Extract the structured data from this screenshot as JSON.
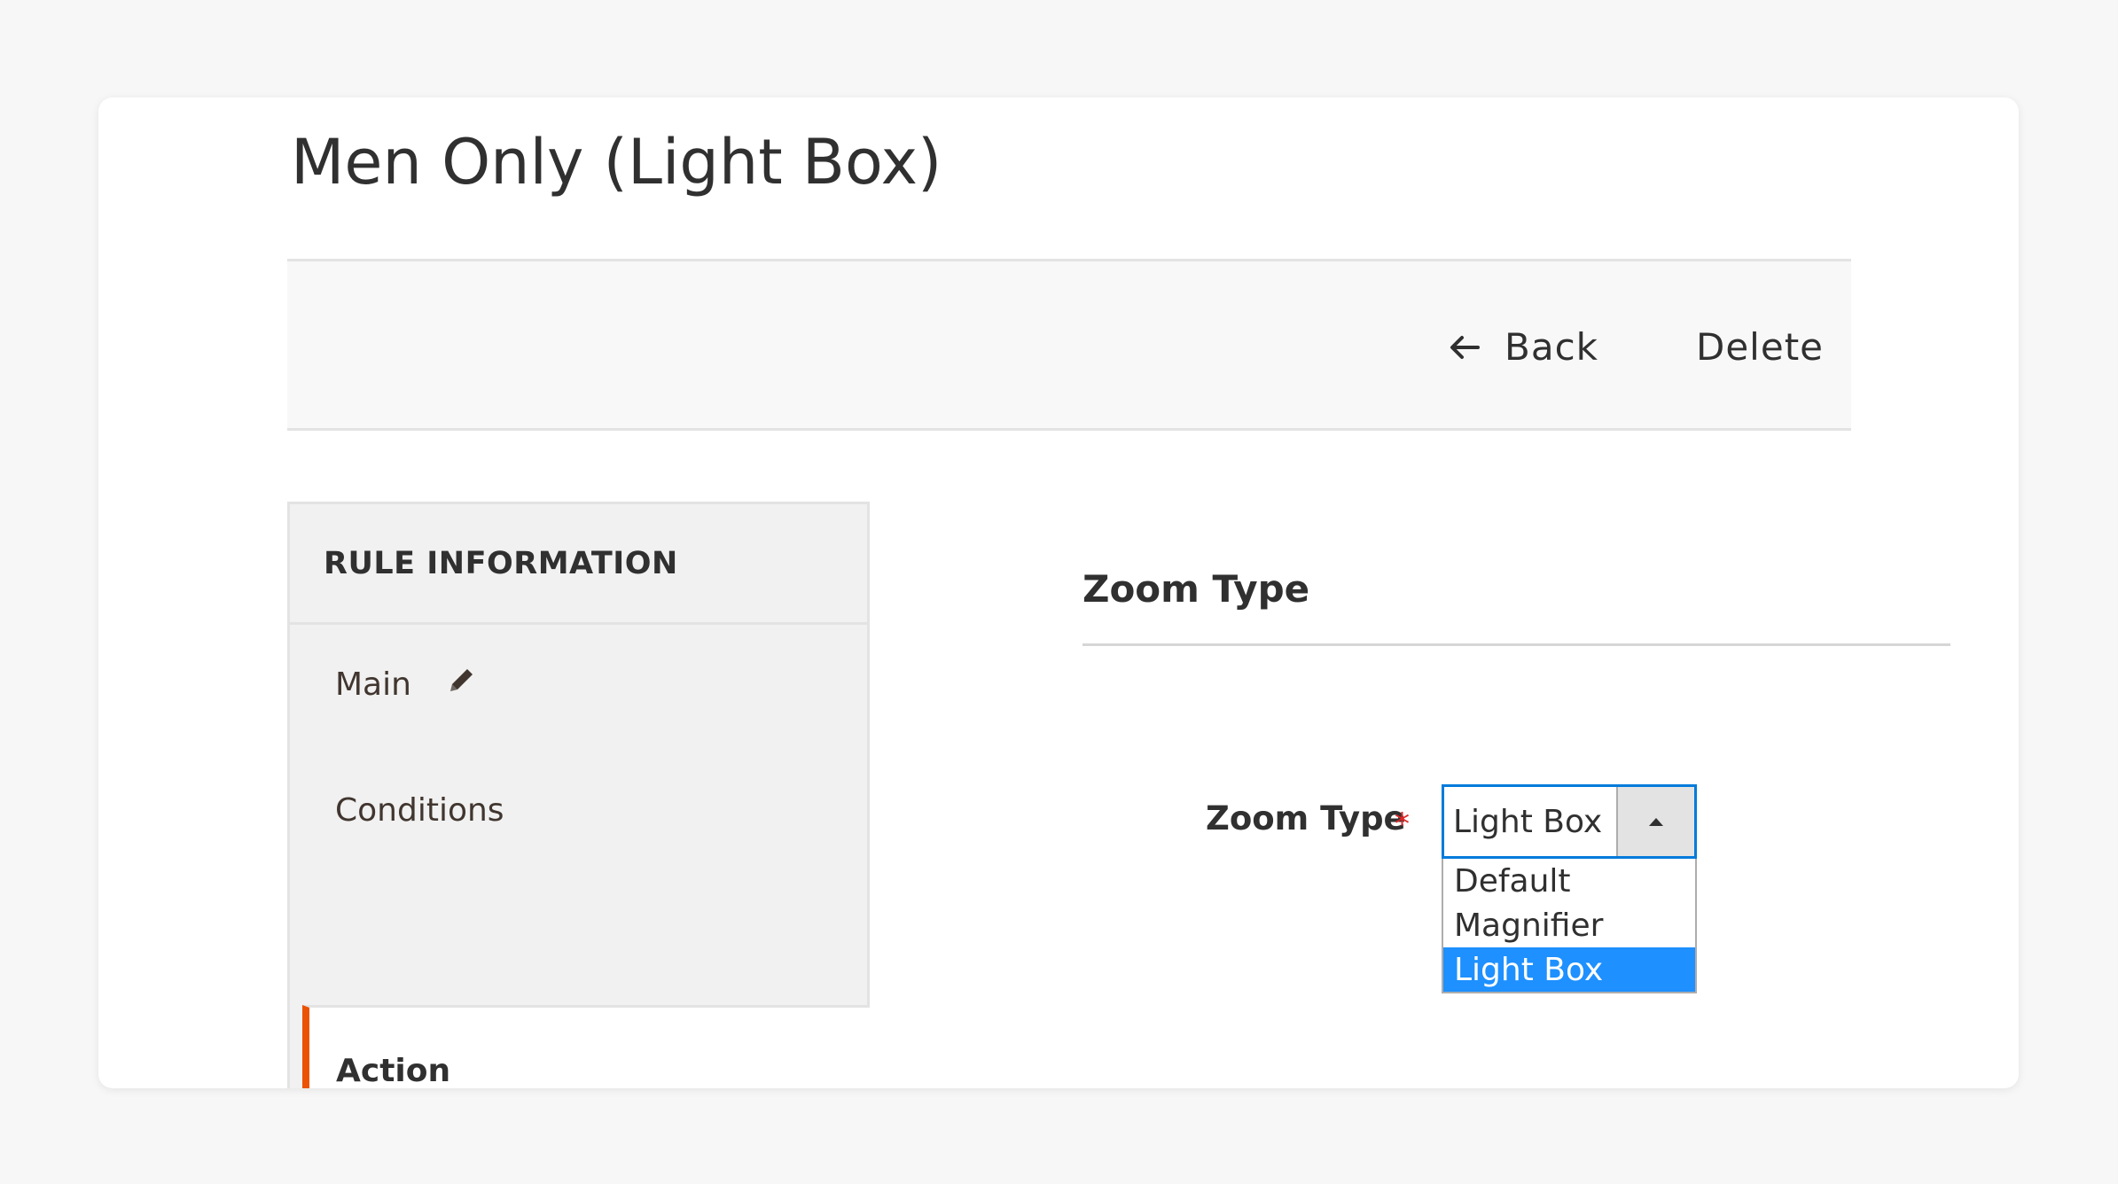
{
  "page": {
    "title": "Men Only (Light Box)"
  },
  "actions": {
    "back_label": "Back",
    "delete_label": "Delete"
  },
  "sidebar": {
    "header": "RULE INFORMATION",
    "items": [
      {
        "label": "Main",
        "icon": "pencil-icon",
        "active": false
      },
      {
        "label": "Conditions",
        "active": false
      },
      {
        "label": "Action",
        "active": true
      }
    ]
  },
  "section": {
    "title": "Zoom Type"
  },
  "zoom_field": {
    "label": "Zoom Type",
    "required_marker": "*",
    "selected_value": "Light Box",
    "options": [
      "Default",
      "Magnifier",
      "Light Box"
    ],
    "dropdown_open": true
  },
  "colors": {
    "accent_active_tab": "#eb5202",
    "select_focus_border": "#007bdb",
    "selected_option_bg": "#1e90ff",
    "required_star": "#e22626"
  }
}
